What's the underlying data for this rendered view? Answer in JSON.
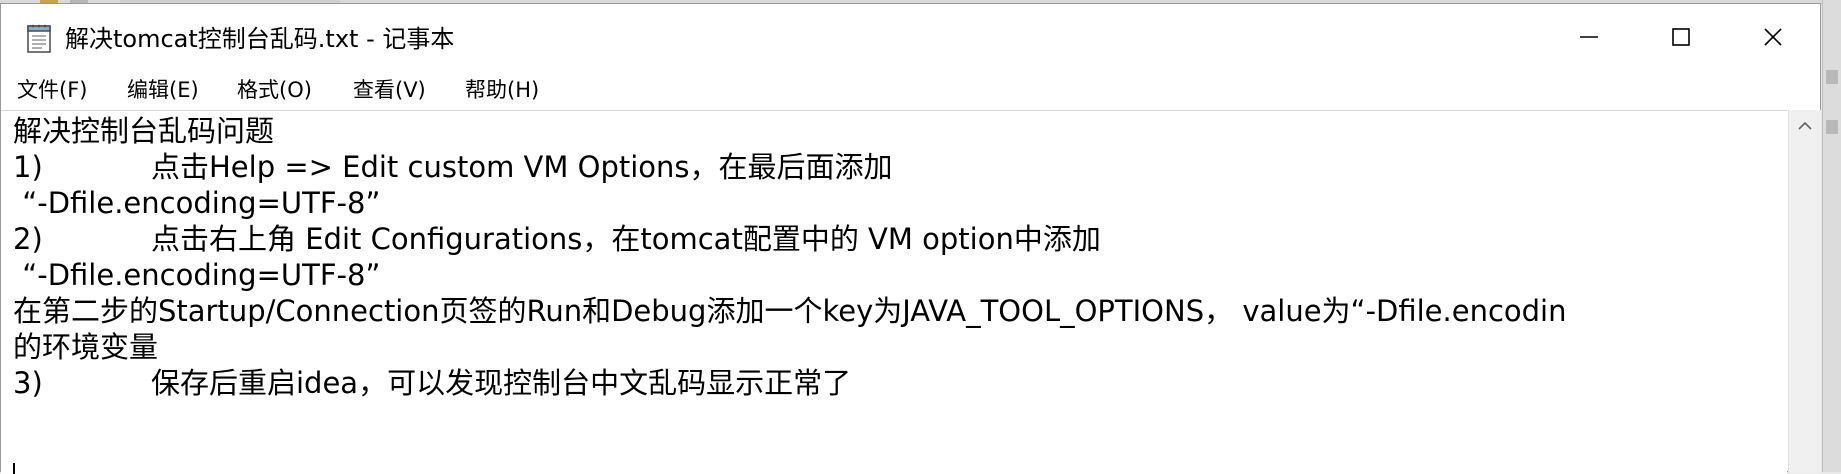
{
  "window": {
    "title": "解决tomcat控制台乱码.txt - 记事本",
    "controls": {
      "minimize": "minimize-icon",
      "maximize": "maximize-icon",
      "close": "close-icon"
    }
  },
  "menu": [
    {
      "label": "文件(F)"
    },
    {
      "label": "编辑(E)"
    },
    {
      "label": "格式(O)"
    },
    {
      "label": "查看(V)"
    },
    {
      "label": "帮助(H)"
    }
  ],
  "editor": {
    "lines": [
      "解决控制台乱码问题",
      "1)\t点击Help => Edit custom VM Options，在最后面添加",
      " “-Dfile.encoding=UTF-8”",
      "2)\t点击右上角 Edit Configurations，在tomcat配置中的 VM option中添加",
      " “-Dfile.encoding=UTF-8”",
      "在第二步的Startup/Connection页签的Run和Debug添加一个key为JAVA_TOOL_OPTIONS， value为“-Dfile.encodin",
      "的环境变量",
      "3)\t保存后重启idea，可以发现控制台中文乱码显示正常了"
    ]
  },
  "colors": {
    "text": "#000000",
    "window_bg": "#ffffff",
    "scrollbar_bg": "#f0f0f0"
  }
}
